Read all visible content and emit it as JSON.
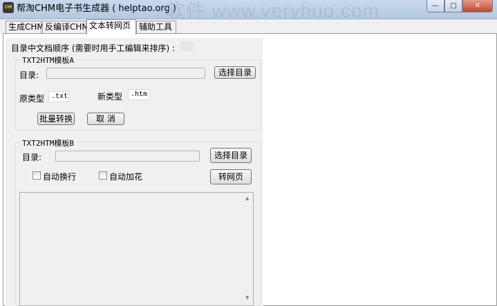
{
  "window": {
    "app_icon": "CHM",
    "title": "帮淘CHM电子书生成器 ( helptao.org )",
    "watermark": "软件 www.veryhuo.com"
  },
  "tabs": [
    {
      "label": "生成CHM",
      "active": false
    },
    {
      "label": "反编译CHM",
      "active": false
    },
    {
      "label": "文本转网页",
      "active": true
    },
    {
      "label": "辅助工具",
      "active": false
    }
  ],
  "main": {
    "order_label": "目录中文档顺序 (需要时用手工编辑来排序) :",
    "groupA": {
      "title": "TXT2HTM模板A",
      "dir_label": "目录:",
      "dir_value": "",
      "choose_dir_button": "选择目录",
      "src_type_label": "原类型",
      "src_type_value": ".txt",
      "new_type_label": "新类型",
      "new_type_value": ".htm",
      "batch_button": "批量转换",
      "cancel_button": "取 消"
    },
    "groupB": {
      "title": "TXT2HTM模板B",
      "dir_label": "目录:",
      "dir_value": "",
      "choose_dir_button": "选择目录",
      "auto_wrap_label": "自动换行",
      "auto_wrap_checked": false,
      "auto_flower_label": "自动加花",
      "auto_flower_checked": false,
      "convert_button": "转网页",
      "memo_text": ""
    }
  },
  "colors": {
    "titlebar": "#c9d9ec",
    "panel": "#f0f0f0",
    "close_button": "#c5462e"
  }
}
